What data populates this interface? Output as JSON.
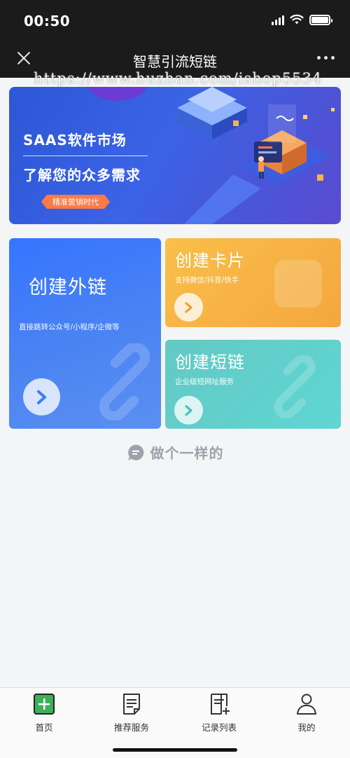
{
  "status_bar": {
    "time": "00:50"
  },
  "nav": {
    "title": "智慧引流短链"
  },
  "watermark": "https://www.huzhan.com/ishop5534",
  "banner": {
    "title": "SAAS软件市场",
    "subtitle": "了解您的众多需求",
    "tag": "精准营销时代"
  },
  "cards": {
    "external": {
      "title": "创建外链",
      "desc": "直接跳转公众号/小程序/企微等"
    },
    "card": {
      "title": "创建卡片",
      "desc": "支持微信/抖音/快手"
    },
    "short": {
      "title": "创建短链",
      "desc": "企业级短网址服务"
    }
  },
  "made_by": "做个一样的",
  "tabbar": {
    "items": [
      {
        "label": "首页",
        "icon": "plus-square-icon"
      },
      {
        "label": "推荐服务",
        "icon": "document-icon"
      },
      {
        "label": "记录列表",
        "icon": "document-add-icon"
      },
      {
        "label": "我的",
        "icon": "user-icon"
      }
    ]
  },
  "colors": {
    "nav_bg": "#1b1b1b",
    "external_card": "#3b78fb",
    "card_card": "#f6b243",
    "short_card": "#62cfcb",
    "home_tab_accent": "#3db05a"
  }
}
